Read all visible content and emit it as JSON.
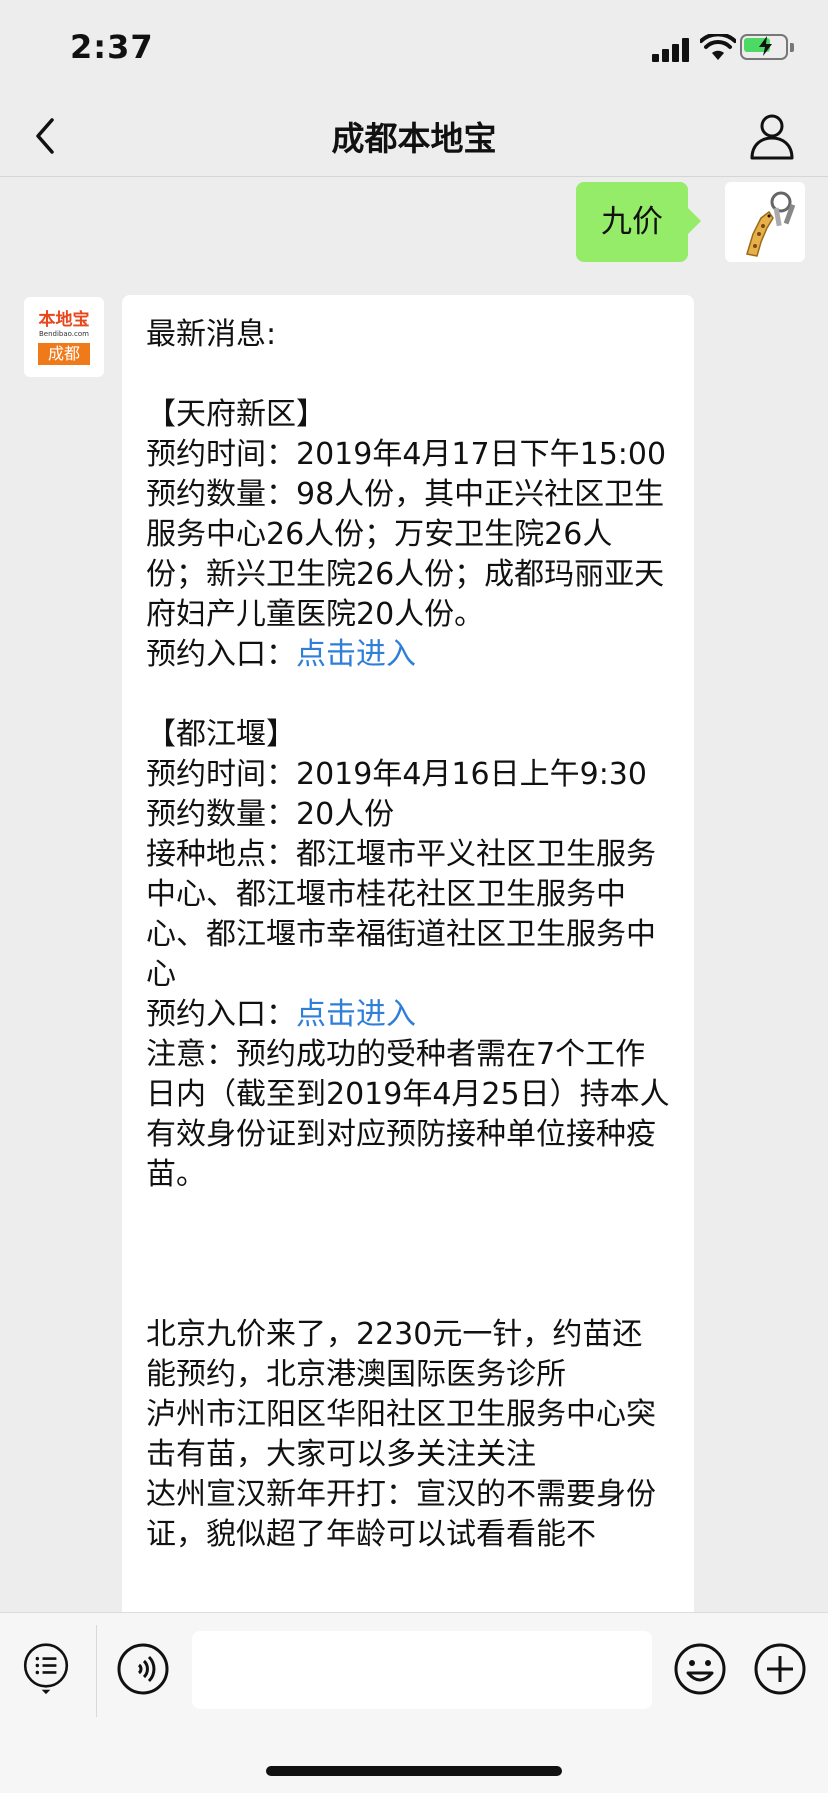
{
  "status": {
    "time": "2:37"
  },
  "header": {
    "title": "成都本地宝"
  },
  "messages": {
    "outgoing": "九价",
    "bot_logo": {
      "brand": "本地宝",
      "domain": "Bendibao.com",
      "city": "成都"
    },
    "incoming": {
      "intro": "最新消息:",
      "section1": {
        "title": "【天府新区】",
        "time": "预约时间：2019年4月17日下午15:00",
        "quota": "预约数量：98人份，其中正兴社区卫生服务中心26人份；万安卫生院26人份；新兴卫生院26人份；成都玛丽亚天府妇产儿童医院20人份。",
        "entry_label": "预约入口：",
        "entry_link": "点击进入"
      },
      "section2": {
        "title": "【都江堰】",
        "time": "预约时间：2019年4月16日上午9:30",
        "quota": "预约数量：20人份",
        "location": "接种地点：都江堰市平义社区卫生服务中心、都江堰市桂花社区卫生服务中心、都江堰市幸福街道社区卫生服务中心",
        "entry_label": "预约入口：",
        "entry_link": "点击进入",
        "note": "注意：预约成功的受种者需在7个工作日内（截至到2019年4月25日）持本人有效身份证到对应预防接种单位接种疫苗。"
      },
      "more": [
        "北京九价来了，2230元一针，约苗还能预约，北京港澳国际医务诊所",
        "泸州市江阳区华阳社区卫生服务中心突击有苗，大家可以多关注关注",
        "达州宣汉新年开打：宣汉的不需要身份证，貌似超了年龄可以试看看能不"
      ]
    }
  }
}
